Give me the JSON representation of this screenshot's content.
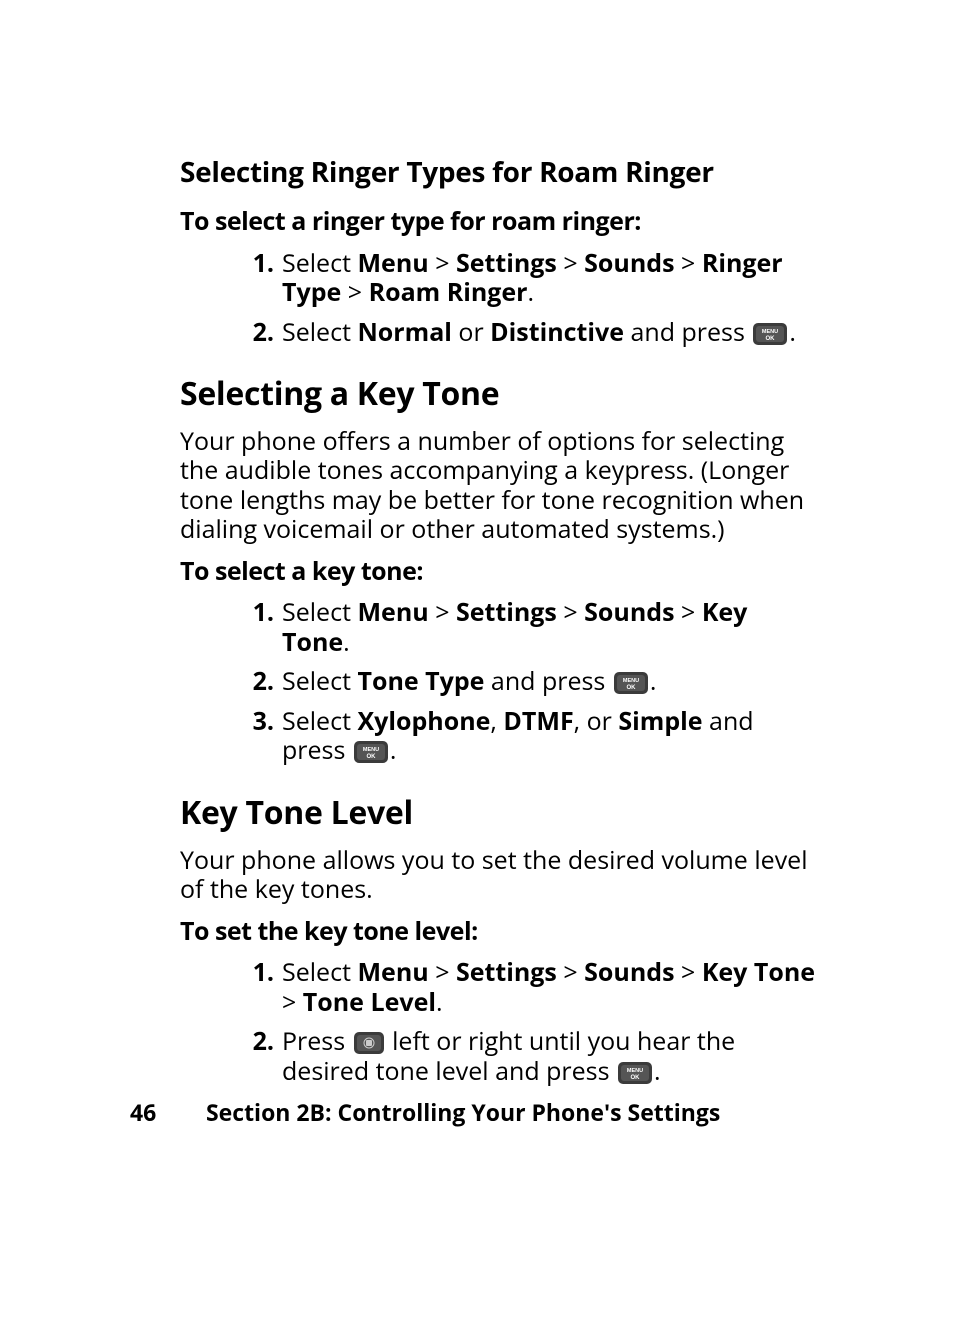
{
  "section1": {
    "heading": "Selecting Ringer Types for Roam Ringer",
    "subhead": "To select a ringer type for roam ringer:",
    "steps": {
      "s1": {
        "num": "1.",
        "pre": "Select ",
        "menu": "Menu",
        "gt1": " > ",
        "settings": "Settings",
        "gt2": " > ",
        "sounds": "Sounds",
        "gt3": " > ",
        "ringer_type": "Ringer Type",
        "gt4": " > ",
        "roam_ringer": "Roam Ringer",
        "period": "."
      },
      "s2": {
        "num": "2.",
        "pre": "Select ",
        "normal": "Normal",
        "or": " or ",
        "distinctive": "Distinctive",
        "and_press": " and press ",
        "period": "."
      }
    }
  },
  "section2": {
    "heading": "Selecting a Key Tone",
    "body": "Your phone offers a number of options for selecting the audible tones accompanying a keypress. (Longer tone lengths may be better for tone recognition when dialing voicemail or other automated systems.)",
    "subhead": "To select a key tone:",
    "steps": {
      "s1": {
        "num": "1.",
        "pre": "Select ",
        "menu": "Menu",
        "gt1": " > ",
        "settings": "Settings",
        "gt2": " > ",
        "sounds": "Sounds",
        "gt3": " > ",
        "key_tone": "Key Tone",
        "period": "."
      },
      "s2": {
        "num": "2.",
        "pre": "Select ",
        "tone_type": "Tone Type",
        "and_press": " and press ",
        "period": "."
      },
      "s3": {
        "num": "3.",
        "pre": "Select ",
        "xylophone": "Xylophone",
        "comma": ", ",
        "dtmf": "DTMF",
        "comma_or": ", or ",
        "simple": "Simple",
        "and_press": " and press ",
        "period": "."
      }
    }
  },
  "section3": {
    "heading": "Key Tone Level",
    "body": "Your phone allows you to set the desired volume level of the key tones.",
    "subhead": "To set the key tone level:",
    "steps": {
      "s1": {
        "num": "1.",
        "pre": "Select ",
        "menu": "Menu",
        "gt1": " > ",
        "settings": "Settings",
        "gt2": " > ",
        "sounds": "Sounds",
        "gt3": " > ",
        "key_tone": "Key Tone",
        "gt4": " > ",
        "tone_level": "Tone Level",
        "period": "."
      },
      "s2": {
        "num": "2.",
        "pre": "Press ",
        "mid": " left or right until you hear the desired tone level and press ",
        "period": "."
      }
    }
  },
  "footer": {
    "page": "46",
    "section": "Section 2B: Controlling Your Phone's Settings"
  },
  "icons": {
    "menu_ok": "menu-ok-key-icon",
    "nav": "nav-key-icon"
  }
}
